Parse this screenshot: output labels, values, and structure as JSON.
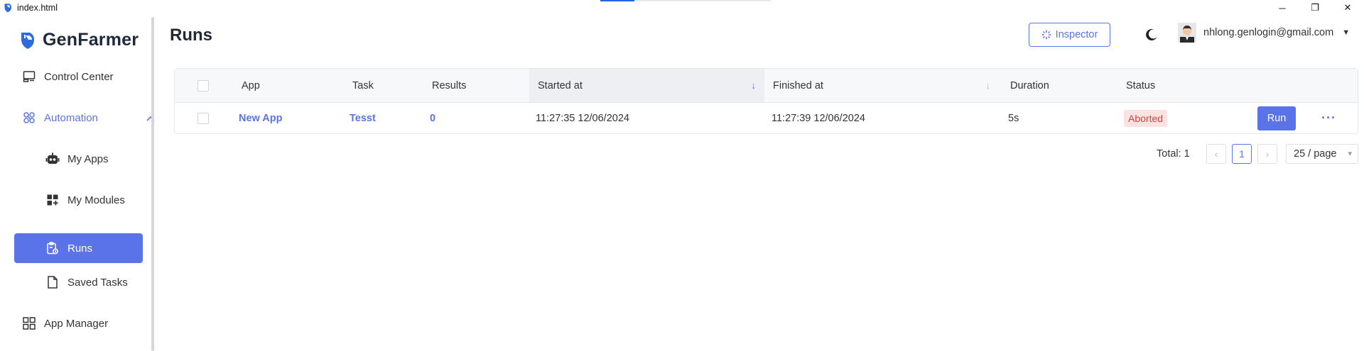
{
  "window": {
    "title": "index.html",
    "controls": {
      "minimize": "─",
      "restore": "❐",
      "close": "✕"
    }
  },
  "brand": {
    "name": "GenFarmer",
    "color": "#3b6fe0"
  },
  "sidebar": {
    "items": [
      {
        "label": "Control Center",
        "icon": "monitor-icon"
      },
      {
        "label": "Automation",
        "icon": "automation-icon"
      },
      {
        "label": "My Apps",
        "icon": "robot-icon"
      },
      {
        "label": "My Modules",
        "icon": "modules-icon"
      },
      {
        "label": "Runs",
        "icon": "runs-icon"
      },
      {
        "label": "Saved Tasks",
        "icon": "file-icon"
      },
      {
        "label": "App Manager",
        "icon": "grid-icon"
      }
    ],
    "active": "Runs"
  },
  "header": {
    "title": "Runs",
    "inspector_label": "Inspector",
    "user_email": "nhlong.genlogin@gmail.com"
  },
  "table": {
    "columns": [
      "App",
      "Task",
      "Results",
      "Started at",
      "Finished at",
      "Duration",
      "Status"
    ],
    "rows": [
      {
        "app": "New App",
        "task": "Tesst",
        "results": "0",
        "started_at": "11:27:35 12/06/2024",
        "finished_at": "11:27:39 12/06/2024",
        "duration": "5s",
        "status": "Aborted",
        "run_label": "Run",
        "more": "···"
      }
    ]
  },
  "pagination": {
    "total_label": "Total: 1",
    "prev": "‹",
    "current_page": "1",
    "next": "›",
    "page_size": "25 / page"
  },
  "colors": {
    "accent": "#5b73e8",
    "aborted_bg": "#fde2e2",
    "aborted_text": "#d14343"
  }
}
